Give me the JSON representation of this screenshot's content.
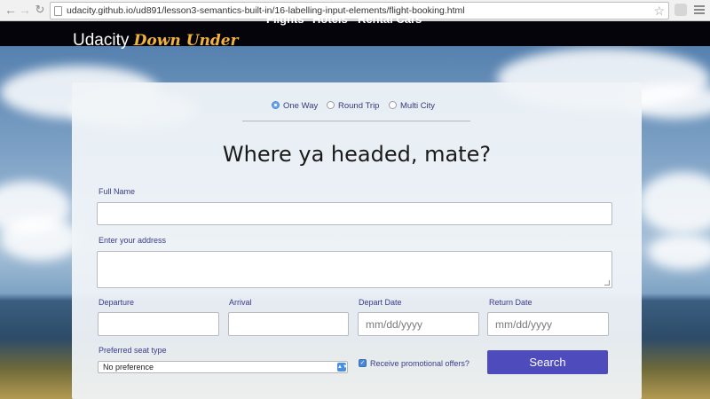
{
  "browser": {
    "url": "udacity.github.io/ud891/lesson3-semantics-built-in/16-labelling-input-elements/flight-booking.html",
    "icons": [
      "back-arrow",
      "forward-arrow",
      "reload",
      "page",
      "bookmark-star",
      "extension",
      "menu"
    ]
  },
  "header": {
    "brand_main": "Udacity",
    "brand_accent": "Down Under",
    "nav": [
      "Flights",
      "Hotels",
      "Rental Cars"
    ]
  },
  "trip_type": {
    "options": [
      "One Way",
      "Round Trip",
      "Multi City"
    ],
    "selected": "One Way"
  },
  "form": {
    "heading": "Where ya headed, mate?",
    "full_name_label": "Full Name",
    "address_label": "Enter your address",
    "departure_label": "Departure",
    "arrival_label": "Arrival",
    "depart_date_label": "Depart Date",
    "return_date_label": "Return Date",
    "date_placeholder": "mm/dd/yyyy",
    "seat_label": "Preferred seat type",
    "seat_value": "No preference",
    "promo_label": "Receive promotional offers?",
    "promo_checked": true,
    "search_label": "Search"
  },
  "colors": {
    "brand_accent": "#f2b33d",
    "button": "#4e4bbd",
    "label": "#3b3b8a"
  }
}
